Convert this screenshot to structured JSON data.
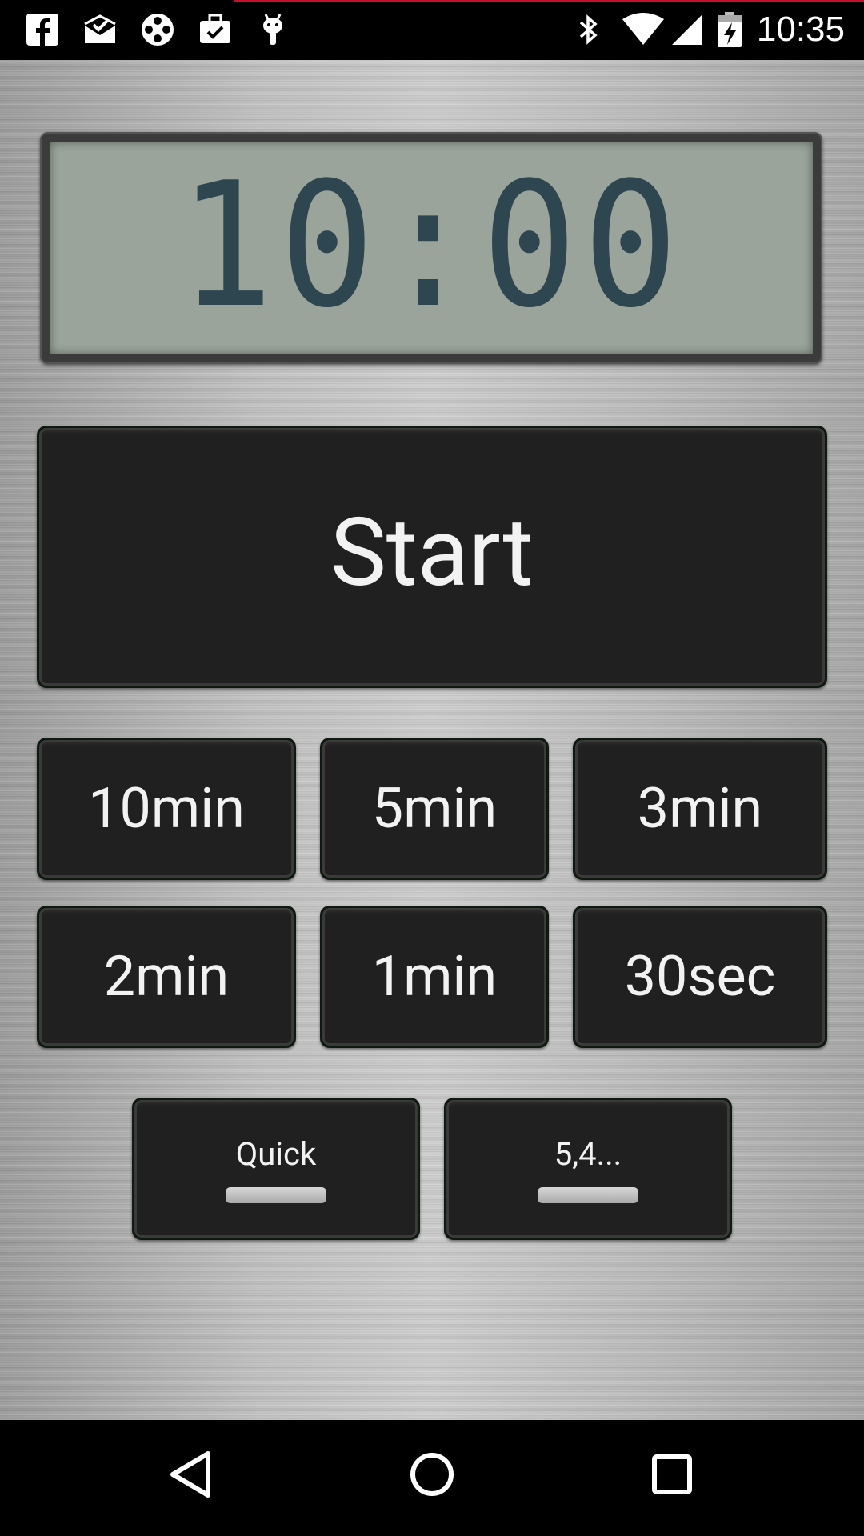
{
  "status_bar": {
    "time": "10:35",
    "left_icons": [
      "facebook-icon",
      "mail-check-icon",
      "film-reel-icon",
      "briefcase-check-icon",
      "android-icon"
    ],
    "right_icons": [
      "bluetooth-icon",
      "wifi-icon",
      "signal-icon",
      "battery-charging-icon"
    ]
  },
  "timer": {
    "display": "10:00"
  },
  "start_button": {
    "label": "Start"
  },
  "presets": [
    {
      "label": "10min"
    },
    {
      "label": "5min"
    },
    {
      "label": "3min"
    },
    {
      "label": "2min"
    },
    {
      "label": "1min"
    },
    {
      "label": "30sec"
    }
  ],
  "mode_buttons": [
    {
      "label": "Quick"
    },
    {
      "label": "5,4..."
    }
  ],
  "colors": {
    "lcd_bg": "#9aa49a",
    "lcd_digits": "#2e4650",
    "button_bg": "#202020",
    "status_accent": "#c8102e"
  }
}
